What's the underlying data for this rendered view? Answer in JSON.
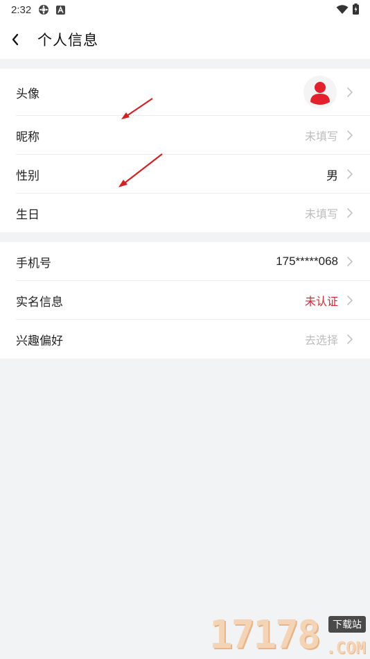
{
  "status_bar": {
    "time": "2:32"
  },
  "header": {
    "title": "个人信息"
  },
  "group_basic": {
    "avatar_label": "头像",
    "nickname_label": "昵称",
    "nickname_value": "未填写",
    "gender_label": "性别",
    "gender_value": "男",
    "birthday_label": "生日",
    "birthday_value": "未填写"
  },
  "group_account": {
    "phone_label": "手机号",
    "phone_value": "175*****068",
    "realname_label": "实名信息",
    "realname_value": "未认证",
    "interest_label": "兴趣偏好",
    "interest_value": "去选择"
  },
  "colors": {
    "accent_red": "#e5202d",
    "placeholder_gray": "#bdbdbd",
    "background": "#f2f3f5"
  },
  "watermark": {
    "digits": "17178",
    "tag": "下载站",
    "suffix": ".COM"
  }
}
